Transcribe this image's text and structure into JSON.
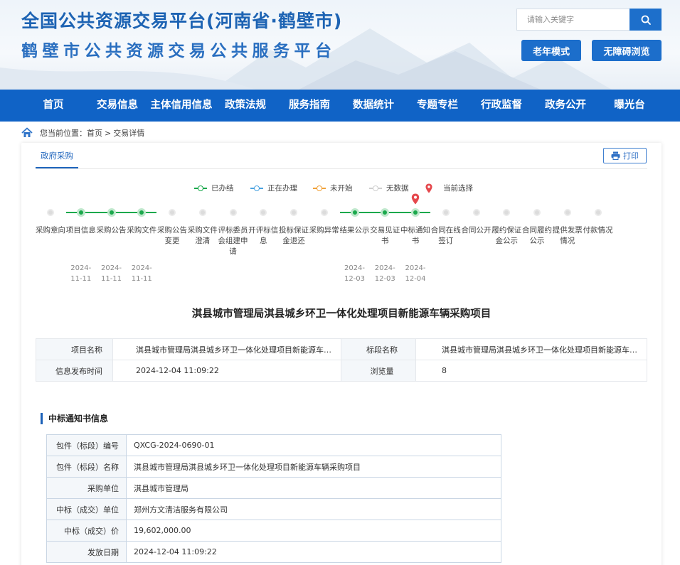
{
  "header": {
    "title_line1": "全国公共资源交易平台(河南省·鹤壁市)",
    "title_line2": "鹤壁市公共资源交易公共服务平台",
    "search_placeholder": "请输入关键字",
    "elder_mode": "老年模式",
    "accessible": "无障碍浏览"
  },
  "nav": [
    "首页",
    "交易信息",
    "主体信用信息",
    "政策法规",
    "服务指南",
    "数据统计",
    "专题专栏",
    "行政监督",
    "政务公开",
    "曝光台"
  ],
  "breadcrumb": {
    "prefix": "您当前位置：",
    "home": "首页",
    "sep": ">",
    "current": "交易详情"
  },
  "tab": "政府采购",
  "print": "打印",
  "legend": {
    "done": "已办结",
    "doing": "正在办理",
    "pending": "未开始",
    "nodata": "无数据",
    "current": "当前选择",
    "colors": {
      "done": "#1aa84c",
      "doing": "#4aa3e0",
      "pending": "#f0a23a",
      "nodata": "#cfcfcf",
      "current": "#e5484d"
    }
  },
  "steps": [
    {
      "label": "采购意向",
      "state": "grey",
      "date": ""
    },
    {
      "label": "项目信息",
      "state": "done",
      "date": "2024-11-11"
    },
    {
      "label": "采购公告",
      "state": "done",
      "date": "2024-11-11"
    },
    {
      "label": "采购文件",
      "state": "done",
      "date": "2024-11-11"
    },
    {
      "label": "采购公告变更",
      "state": "grey",
      "date": ""
    },
    {
      "label": "采购文件澄清",
      "state": "grey",
      "date": ""
    },
    {
      "label": "评标委员会组建申请",
      "state": "grey",
      "date": ""
    },
    {
      "label": "开评标信息",
      "state": "grey",
      "date": ""
    },
    {
      "label": "投标保证金退还",
      "state": "grey",
      "date": ""
    },
    {
      "label": "采购异常",
      "state": "grey",
      "date": ""
    },
    {
      "label": "结果公示",
      "state": "done",
      "date": "2024-12-03"
    },
    {
      "label": "交易见证书",
      "state": "done",
      "date": "2024-12-03"
    },
    {
      "label": "中标通知书",
      "state": "done",
      "date": "2024-12-04",
      "current": true
    },
    {
      "label": "合同在线签订",
      "state": "grey",
      "date": ""
    },
    {
      "label": "合同公开",
      "state": "grey",
      "date": ""
    },
    {
      "label": "履约保证金公示",
      "state": "grey",
      "date": ""
    },
    {
      "label": "合同履约公示",
      "state": "grey",
      "date": ""
    },
    {
      "label": "提供发票情况",
      "state": "grey",
      "date": ""
    },
    {
      "label": "付款情况",
      "state": "grey",
      "date": ""
    }
  ],
  "project_title": "淇县城市管理局淇县城乡环卫一体化处理项目新能源车辆采购项目",
  "info": {
    "name_label": "项目名称",
    "name": "淇县城市管理局淇县城乡环卫一体化处理项目新能源车辆采购项目",
    "section_label": "标段名称",
    "section": "淇县城市管理局淇县城乡环卫一体化处理项目新能源车辆采购项目",
    "time_label": "信息发布时间",
    "time": "2024-12-04 11:09:22",
    "views_label": "浏览量",
    "views": "8"
  },
  "notice": {
    "title": "中标通知书信息",
    "rows": [
      {
        "k": "包件（标段）编号",
        "v": "QXCG-2024-0690-01"
      },
      {
        "k": "包件（标段）名称",
        "v": "淇县城市管理局淇县城乡环卫一体化处理项目新能源车辆采购项目"
      },
      {
        "k": "采购单位",
        "v": "淇县城市管理局"
      },
      {
        "k": "中标（成交）单位",
        "v": "郑州方文清洁服务有限公司"
      },
      {
        "k": "中标（成交）价",
        "v": "19,602,000.00"
      },
      {
        "k": "发放日期",
        "v": "2024-12-04 11:09:22"
      }
    ]
  }
}
